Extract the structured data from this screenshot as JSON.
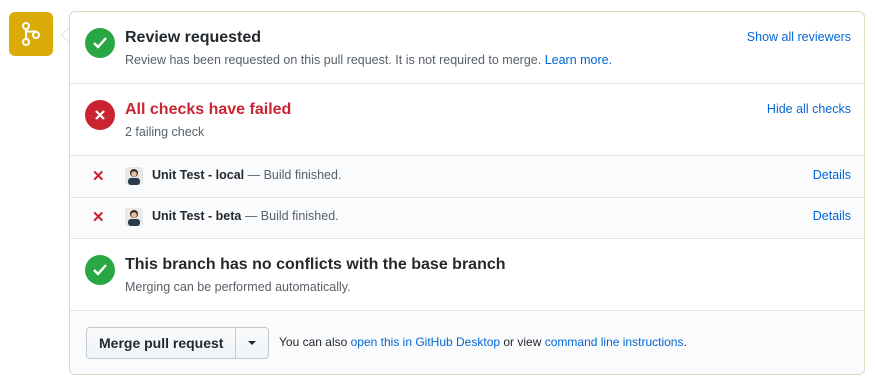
{
  "review": {
    "title": "Review requested",
    "description": "Review has been requested on this pull request. It is not required to merge.",
    "learn_more": "Learn more.",
    "show_reviewers": "Show all reviewers"
  },
  "checks": {
    "title": "All checks have failed",
    "summary": "2 failing check",
    "hide_checks": "Hide all checks",
    "items": [
      {
        "name": "Unit Test - local",
        "status": " — Build finished.",
        "details": "Details"
      },
      {
        "name": "Unit Test - beta",
        "status": " — Build finished.",
        "details": "Details"
      }
    ]
  },
  "conflicts": {
    "title": "This branch has no conflicts with the base branch",
    "description": "Merging can be performed automatically."
  },
  "merge": {
    "button_label": "Merge pull request",
    "hint_prefix": "You can also ",
    "desktop_link": "open this in GitHub Desktop",
    "hint_middle": " or view ",
    "cli_link": "command line instructions",
    "hint_suffix": "."
  },
  "icons": {
    "merge": "git-merge-icon",
    "success": "check-circle-icon",
    "failure": "x-circle-icon",
    "check_failed": "x-icon",
    "avatar": "avatar",
    "dropdown": "triangle-down-icon"
  },
  "colors": {
    "merge_pending": "#dbab0a",
    "success": "#28a745",
    "failure": "#cb2431",
    "link": "#0366d6"
  }
}
